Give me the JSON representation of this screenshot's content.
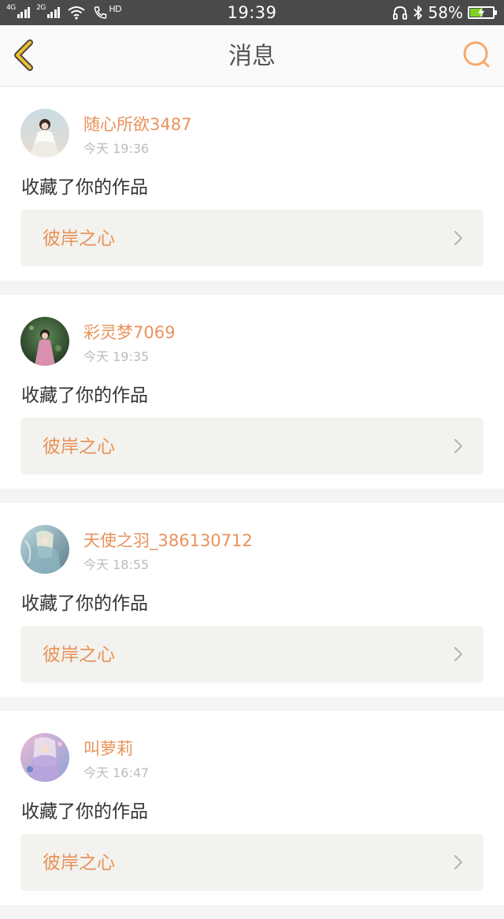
{
  "status_bar": {
    "network_1": "4G",
    "network_2": "2G",
    "hd_label": "HD",
    "time": "19:39",
    "battery_percent": "58%",
    "battery_level": 0.58
  },
  "header": {
    "title": "消息",
    "back_icon": "chevron-left-icon",
    "search_icon": "search-icon"
  },
  "messages": [
    {
      "username": "随心所欲3487",
      "time": "今天 19:36",
      "action": "收藏了你的作品",
      "work_title": "彼岸之心"
    },
    {
      "username": "彩灵梦7069",
      "time": "今天 19:35",
      "action": "收藏了你的作品",
      "work_title": "彼岸之心"
    },
    {
      "username": "天使之羽_386130712",
      "time": "今天 18:55",
      "action": "收藏了你的作品",
      "work_title": "彼岸之心"
    },
    {
      "username": "叫萝莉",
      "time": "今天 16:47",
      "action": "收藏了你的作品",
      "work_title": "彼岸之心"
    }
  ],
  "colors": {
    "accent": "#e8925a",
    "back_icon": "#f0c02a",
    "status_bar_bg": "#4a4a4a",
    "work_box_bg": "#f3f2ee",
    "battery_fill": "#7ed321"
  }
}
